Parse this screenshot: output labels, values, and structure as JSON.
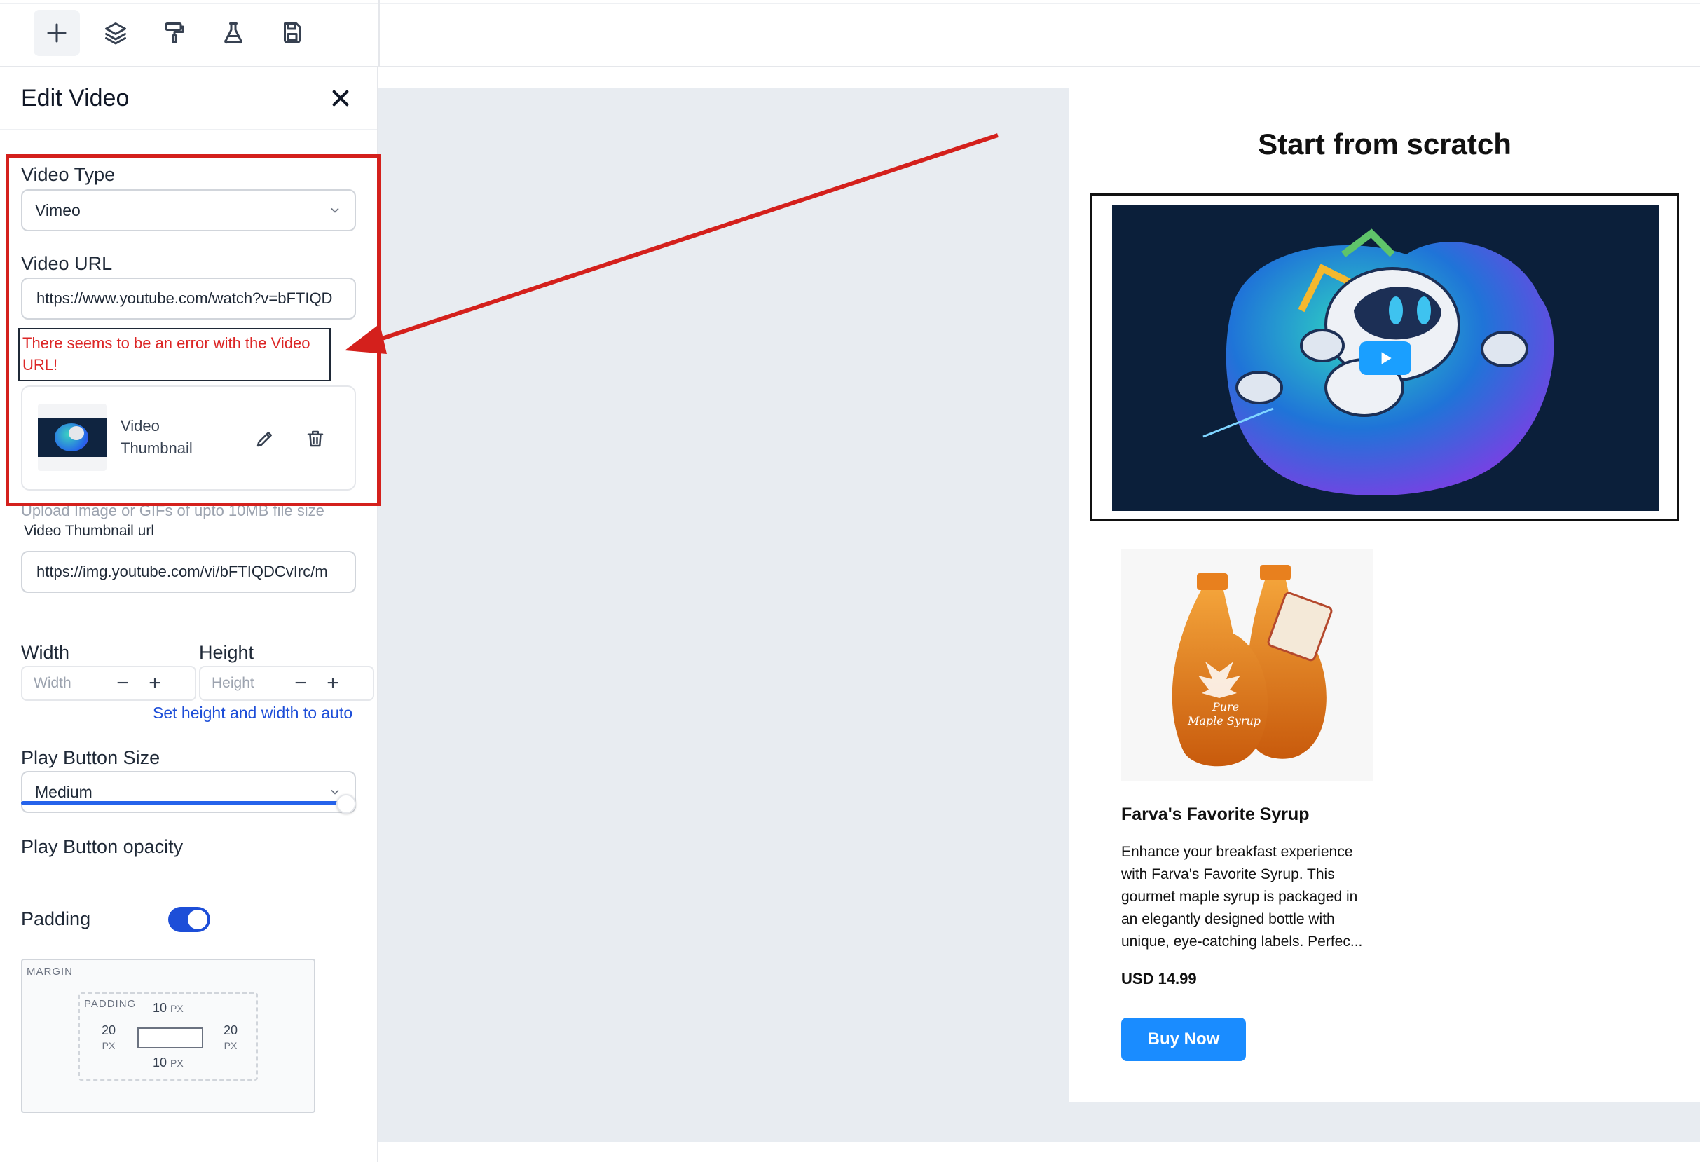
{
  "toolbar": {
    "buttons": [
      "add-icon",
      "layers-icon",
      "paint-roller-icon",
      "flask-icon",
      "save-icon"
    ]
  },
  "sidebar": {
    "title": "Edit Video",
    "video_type": {
      "label": "Video Type",
      "value": "Vimeo"
    },
    "video_url": {
      "label": "Video URL",
      "value": "https://www.youtube.com/watch?v=bFTIQD"
    },
    "error": "There seems to be an error with the Video URL!",
    "thumbnail": {
      "label": "Video Thumbnail"
    },
    "upload_hint": "Upload Image or GIFs of upto 10MB file size",
    "thumbnail_url": {
      "label": "Video Thumbnail url",
      "value": "https://img.youtube.com/vi/bFTIQDCvIrc/m"
    },
    "width": {
      "label": "Width",
      "placeholder": "Width"
    },
    "height": {
      "label": "Height",
      "placeholder": "Height"
    },
    "auto_link": "Set height and width to auto",
    "play_button_size": {
      "label": "Play Button Size",
      "value": "Medium"
    },
    "play_button_opacity": {
      "label": "Play Button opacity",
      "value": 1.0
    },
    "padding": {
      "label": "Padding",
      "enabled": true
    },
    "box_model": {
      "margin_label": "MARGIN",
      "padding_label": "PADDING",
      "top": "10",
      "right": "20",
      "bottom": "10",
      "left": "20",
      "unit": "PX"
    }
  },
  "canvas": {
    "title": "Start from scratch",
    "product": {
      "name": "Farva's Favorite Syrup",
      "description": "Enhance your breakfast experience with Farva's Favorite Syrup. This gourmet maple syrup is packaged in an elegantly designed bottle with unique, eye-catching labels. Perfec...",
      "price": "USD 14.99",
      "cta": "Buy Now"
    }
  },
  "colors": {
    "accent": "#2563eb",
    "error": "#dc2626",
    "annotation": "#d4201c",
    "buy_button": "#1a8cff",
    "canvas_bg": "#e8ecf1"
  }
}
